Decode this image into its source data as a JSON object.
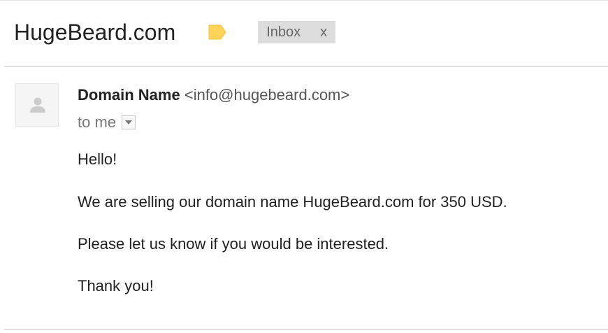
{
  "email": {
    "subject": "HugeBeard.com",
    "label_icon": "label-tag-icon",
    "label_color": "#ffd359",
    "label_chip": {
      "text": "Inbox",
      "remove": "x"
    },
    "sender": {
      "name": "Domain Name",
      "email": "<info@hugebeard.com>",
      "avatar_icon": "person-placeholder-icon"
    },
    "recipient": "to me",
    "details_icon": "chevron-down-icon",
    "body": [
      "Hello!",
      "We are selling our domain name HugeBeard.com for 350 USD.",
      "Please let us know if you would be interested.",
      "Thank you!"
    ]
  }
}
